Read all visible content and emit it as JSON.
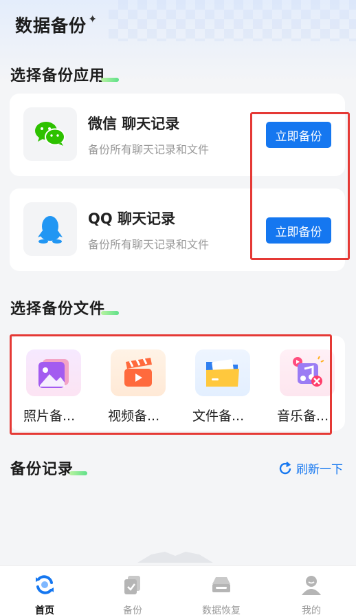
{
  "header": {
    "title": "数据备份"
  },
  "apps_section": {
    "title": "选择备份应用",
    "items": [
      {
        "name": "微信 聊天记录",
        "desc": "备份所有聊天记录和文件",
        "button": "立即备份",
        "icon": "wechat-icon"
      },
      {
        "name": "QQ 聊天记录",
        "desc": "备份所有聊天记录和文件",
        "button": "立即备份",
        "icon": "qq-icon"
      }
    ]
  },
  "files_section": {
    "title": "选择备份文件",
    "items": [
      {
        "label": "照片备...",
        "icon": "photo-icon"
      },
      {
        "label": "视频备...",
        "icon": "video-icon"
      },
      {
        "label": "文件备...",
        "icon": "folder-icon"
      },
      {
        "label": "音乐备...",
        "icon": "music-icon"
      }
    ]
  },
  "records_section": {
    "title": "备份记录",
    "refresh_label": "刷新一下"
  },
  "tabbar": {
    "tabs": [
      {
        "label": "首页",
        "icon": "home-sync-icon",
        "active": true
      },
      {
        "label": "备份",
        "icon": "backup-icon",
        "active": false
      },
      {
        "label": "数据恢复",
        "icon": "recovery-icon",
        "active": false
      },
      {
        "label": "我的",
        "icon": "profile-icon",
        "active": false
      }
    ]
  },
  "colors": {
    "accent": "#1577f0",
    "highlight": "#e53935",
    "wechat": "#2dc100"
  }
}
